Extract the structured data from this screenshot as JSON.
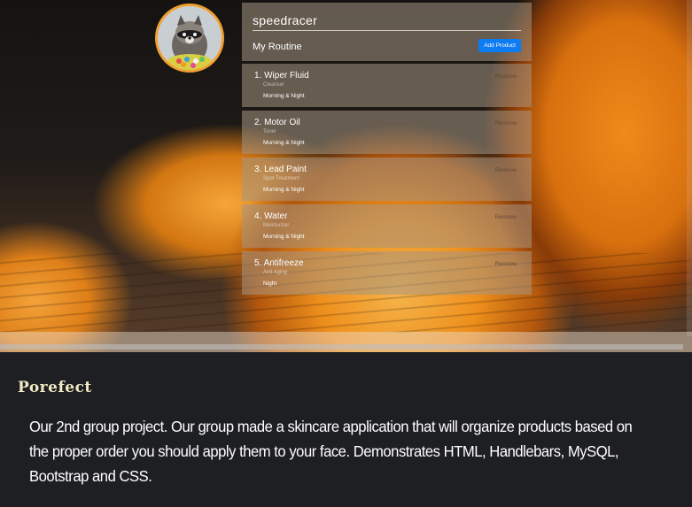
{
  "app": {
    "username": "speedracer",
    "routine_title": "My Routine",
    "add_button": "Add Product",
    "remove_label": "Remove"
  },
  "products": [
    {
      "name": "1. Wiper Fluid",
      "category": "Cleanser",
      "time": "Morning & Night"
    },
    {
      "name": "2. Motor Oil",
      "category": "Toner",
      "time": "Morning & Night"
    },
    {
      "name": "3. Lead Paint",
      "category": "Spot Treatment",
      "time": "Morning & Night"
    },
    {
      "name": "4. Water",
      "category": "Moisturizer",
      "time": "Morning & Night"
    },
    {
      "name": "5. Antifreeze",
      "category": "Anti Aging",
      "time": "Night"
    }
  ],
  "caption": {
    "title": "Porefect",
    "description": "Our 2nd group project. Our group made a skincare application that will organize products based on the proper order you should apply them to your face. Demonstrates HTML, Handlebars, MySQL, Bootstrap and CSS."
  },
  "colors": {
    "accent": "#0d7bf2",
    "avatar_border": "#f0a030",
    "caption_bg": "#1e1f22",
    "title_color": "#f3e9c4"
  },
  "icons": {
    "avatar": "raccoon-avatar"
  }
}
